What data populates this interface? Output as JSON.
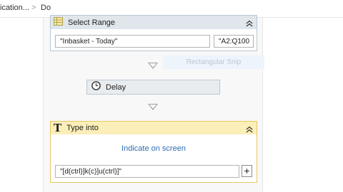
{
  "breadcrumb": {
    "items": [
      "ication...",
      "Do"
    ],
    "separator": ">"
  },
  "activities": {
    "select_range": {
      "title": "Select Range",
      "sheet_value": "\"Inbasket - Today\"",
      "range_value": "\"A2:Q100"
    },
    "delay": {
      "title": "Delay"
    },
    "type_into": {
      "title": "Type into",
      "indicate_label": "Indicate on screen",
      "text_value": "\"[d(ctrl)]k(c)]u(ctrl)]\"",
      "add_label": "+"
    }
  },
  "snip_hint": "Rectangular Snip",
  "icons": {
    "select_range": "spreadsheet-icon",
    "delay": "clock-icon",
    "type_into": "type-T-icon",
    "collapse": "chevron-double-up-icon",
    "flow_arrow": "down-triangle-icon"
  },
  "colors": {
    "select_header": "#dfe6ec",
    "type_header": "#fbeeb8",
    "type_border": "#e6c864",
    "link": "#2d6cb3"
  }
}
